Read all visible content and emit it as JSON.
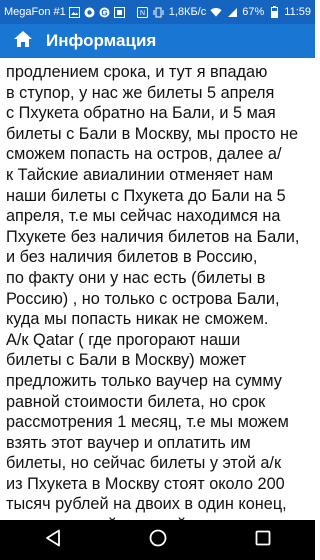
{
  "status_bar": {
    "carrier": "MegaFon #1",
    "speed": "1,8КБ/с",
    "battery": "67%",
    "time": "11:59"
  },
  "app_bar": {
    "title": "Информация"
  },
  "content": {
    "text": "продлением срока, и тут я впадаю\nв ступор, у нас же билеты 5 апреля\nс Пхукета  обратно на Бали, и 5 мая\nбилеты с Бали в Москву, мы просто не\nсможем попасть на остров, далее  а/\nк Тайские авиалинии отменяет нам\nнаши билеты с Пхукета до Бали на 5\nапреля, т.е мы сейчас находимся на\nПхукете без наличия билетов на Бали,\nи без наличия билетов в  Россию,\nпо факту  они у нас есть (билеты в\nРоссию) , но только с острова Бали,\nкуда мы попасть никак не сможем.\nА/к Qatar ( где прогорают наши\nбилеты с Бали в Москву) может\nпредложить только ваучер на сумму\nравной стоимости билета, но срок\nрассмотрения 1 месяц, т.е мы можем\nвзять этот ваучер и оплатить им\nбилеты, но сейчас билеты у этой а/к\nиз Пхукета в Москву стоят около 200\nтысяч рублей на двоих в один конец,\nпросто в такой сложной ситуации\nцены на билеты стоят космических\nденег, к сравнению мы брали билеты"
  },
  "icons": {
    "home": "home-icon",
    "back": "back-triangle-icon",
    "home_nav": "home-circle-icon",
    "recents": "recents-square-icon"
  },
  "colors": {
    "status_bar": "#1565c0",
    "app_bar": "#1976d2",
    "nav_bar": "#000000"
  }
}
